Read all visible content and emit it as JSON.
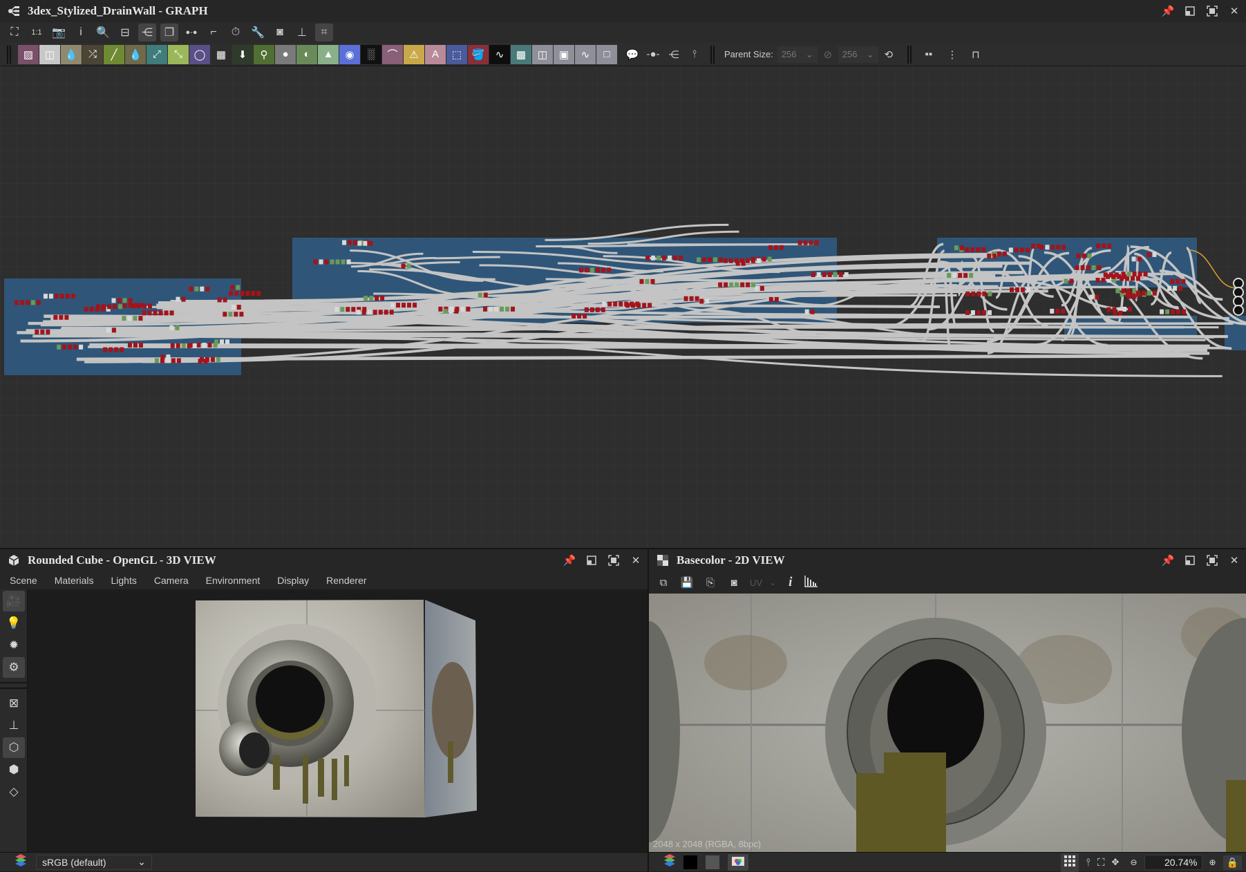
{
  "graph": {
    "title": "3dex_Stylized_DrainWall - GRAPH",
    "title_icon": "graph-icon",
    "window_controls": [
      "pin-icon",
      "float-icon",
      "maximize-icon",
      "close-icon"
    ],
    "toolbar_tools": [
      {
        "icon": "frame-all-icon",
        "glyph": "⛶",
        "active": false
      },
      {
        "icon": "zoom-1-1-icon",
        "glyph": "1:1",
        "active": false
      },
      {
        "icon": "camera-icon",
        "glyph": "📷",
        "active": false
      },
      {
        "icon": "info-icon",
        "glyph": "i",
        "active": false
      },
      {
        "icon": "search-icon",
        "glyph": "🔍",
        "active": false
      },
      {
        "icon": "node-link-icon",
        "glyph": "⊟",
        "active": false
      },
      {
        "icon": "hierarchy-icon",
        "glyph": "⋲",
        "active": true
      },
      {
        "icon": "layers-icon",
        "glyph": "❐",
        "active": true
      },
      {
        "icon": "connection-icon",
        "glyph": "●-●",
        "active": false
      },
      {
        "icon": "path-icon",
        "glyph": "⌐",
        "active": false
      },
      {
        "icon": "timer-icon",
        "glyph": "⏱",
        "active": false
      },
      {
        "icon": "wrench-icon",
        "glyph": "🔧",
        "active": false
      },
      {
        "icon": "preview-icon",
        "glyph": "◙",
        "active": false
      },
      {
        "icon": "clean-icon",
        "glyph": "⊥",
        "active": false
      },
      {
        "icon": "align-icon",
        "glyph": "⌗",
        "active": true
      }
    ],
    "node_buttons": [
      {
        "icon": "bitmap-icon",
        "glyph": "▨",
        "color": "#7a4f69"
      },
      {
        "icon": "svg-icon",
        "glyph": "◫",
        "color": "#c8c8c8"
      },
      {
        "icon": "uniform-color-icon",
        "glyph": "💧",
        "color": "#8f8a6f"
      },
      {
        "icon": "shuffle-icon",
        "glyph": "⤮",
        "color": "#4a4535"
      },
      {
        "icon": "curve-icon",
        "glyph": "╱",
        "color": "#6f8a32"
      },
      {
        "icon": "color-picker-icon",
        "glyph": "💧",
        "color": "#6e6a4a"
      },
      {
        "icon": "warp-icon",
        "glyph": "⤢",
        "color": "#3f7c7a"
      },
      {
        "icon": "gradient-icon",
        "glyph": "⤡",
        "color": "#9ab85a"
      },
      {
        "icon": "circle-icon",
        "glyph": "◯",
        "color": "#5a4f86"
      },
      {
        "icon": "grid-icon",
        "glyph": "▦",
        "color": "#2d2d2d"
      },
      {
        "icon": "transform-icon",
        "glyph": "⬇",
        "color": "#2f3b2a"
      },
      {
        "icon": "levels-icon",
        "glyph": "⚲",
        "color": "#4f6f33"
      },
      {
        "icon": "blend-icon",
        "glyph": "●",
        "color": "#7a7a7a"
      },
      {
        "icon": "normal-icon",
        "glyph": "◐",
        "color": "#6b8a5a"
      },
      {
        "icon": "histogram-icon",
        "glyph": "▲",
        "color": "#8ab08a"
      },
      {
        "icon": "hsl-icon",
        "glyph": "◉",
        "color": "#5a70d8"
      },
      {
        "icon": "noise-icon",
        "glyph": "░",
        "color": "#111111"
      },
      {
        "icon": "spline-icon",
        "glyph": "⌒",
        "color": "#8a5f78"
      },
      {
        "icon": "warning-icon",
        "glyph": "⚠",
        "color": "#c9a84a"
      },
      {
        "icon": "text-icon",
        "glyph": "A",
        "color": "#b88a9a"
      },
      {
        "icon": "selection-icon",
        "glyph": "⬚",
        "color": "#4a5a9a"
      },
      {
        "icon": "fill-icon",
        "glyph": "🪣",
        "color": "#8a2f3a"
      },
      {
        "icon": "fx-map-icon",
        "glyph": "∿",
        "color": "#0e0e0e"
      },
      {
        "icon": "tile-icon",
        "glyph": "▩",
        "color": "#4a7a78"
      },
      {
        "icon": "input-color-icon",
        "glyph": "◫",
        "color": "#8f8f99"
      },
      {
        "icon": "input-gray-icon",
        "glyph": "▣",
        "color": "#8f8f99"
      },
      {
        "icon": "input-value-icon",
        "glyph": "∿",
        "color": "#8f8f99"
      },
      {
        "icon": "output-icon",
        "glyph": "□",
        "color": "#8f8f99"
      }
    ],
    "extra_tools": [
      {
        "icon": "comment-icon",
        "glyph": "💬"
      },
      {
        "icon": "dot-icon",
        "glyph": "-●-"
      },
      {
        "icon": "graph-frame-icon",
        "glyph": "⋲"
      },
      {
        "icon": "pin-node-icon",
        "glyph": "⫯"
      }
    ],
    "parent_size": {
      "label": "Parent Size:",
      "width": "256",
      "height": "256",
      "link_icon": "link-icon",
      "reset_icon": "reset-icon"
    },
    "layout_tools": [
      {
        "icon": "align-horizontal-icon",
        "glyph": "▪▪"
      },
      {
        "icon": "align-vertical-icon",
        "glyph": "⋮"
      },
      {
        "icon": "snap-icon",
        "glyph": "⊓"
      }
    ]
  },
  "view3d": {
    "title": "Rounded Cube - OpenGL - 3D VIEW",
    "title_icon": "cube-icon",
    "window_controls": [
      "pin-icon",
      "float-icon",
      "maximize-icon",
      "close-icon"
    ],
    "menu": [
      "Scene",
      "Materials",
      "Lights",
      "Camera",
      "Environment",
      "Display",
      "Renderer"
    ],
    "side_tools": [
      {
        "icon": "camera-tool-icon",
        "glyph": "🎥",
        "active": true
      },
      {
        "icon": "light-icon",
        "glyph": "💡",
        "active": false
      },
      {
        "icon": "environment-light-icon",
        "glyph": "✹",
        "active": false
      },
      {
        "icon": "display-settings-icon",
        "glyph": "⚙",
        "active": true
      },
      {
        "icon": "wireframe-icon",
        "glyph": "⊠",
        "active": false
      },
      {
        "icon": "axis-icon",
        "glyph": "⊥",
        "active": false
      },
      {
        "icon": "cube-shaded-icon",
        "glyph": "⬡",
        "active": true
      },
      {
        "icon": "cube-wire-icon",
        "glyph": "⬢",
        "active": false
      },
      {
        "icon": "plane-icon",
        "glyph": "◇",
        "active": false
      }
    ],
    "color_space": "sRGB (default)",
    "color_space_icon": "color-layers-icon"
  },
  "view2d": {
    "title": "Basecolor - 2D VIEW",
    "title_icon": "checker-icon",
    "window_controls": [
      "pin-icon",
      "float-icon",
      "maximize-icon",
      "close-icon"
    ],
    "tools": [
      {
        "icon": "compare-icon",
        "glyph": "⧉"
      },
      {
        "icon": "save-icon",
        "glyph": "💾"
      },
      {
        "icon": "copy-icon",
        "glyph": "⎘"
      },
      {
        "icon": "export-view-icon",
        "glyph": "◙"
      }
    ],
    "uv_label": "UV",
    "info_icon": "info-icon",
    "histogram_icon": "histogram-icon",
    "resolution": "2048 x 2048 (RGBA, 8bpc)",
    "status_icons": [
      "color-layers-icon",
      "black-bg-icon",
      "gray-bg-icon",
      "color-display-icon"
    ],
    "right_tools": [
      "tiling-icon",
      "pixel-ratio-icon",
      "fit-icon",
      "pan-icon"
    ],
    "zoom": "20.74%",
    "zoom_out_icon": "zoom-out-icon",
    "zoom_in_icon": "zoom-in-icon",
    "lock_icon": "lock-icon"
  }
}
